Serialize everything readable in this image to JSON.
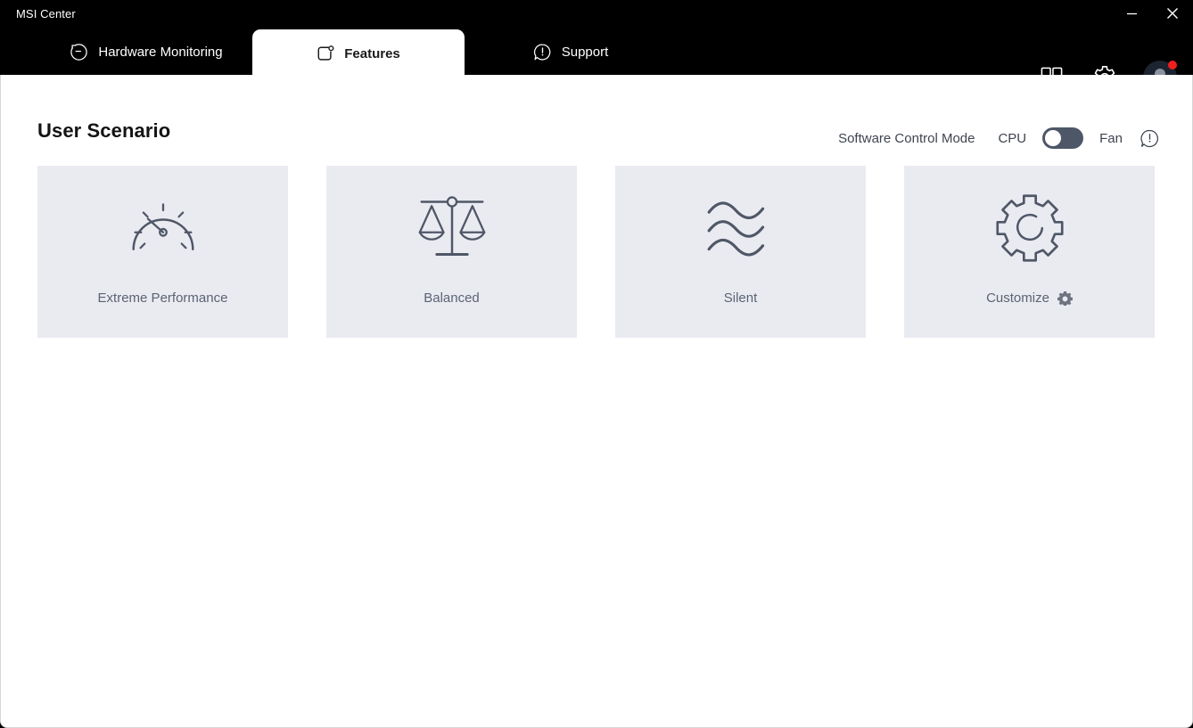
{
  "window": {
    "title": "MSI Center",
    "controls": [
      {
        "name": "minimize",
        "glyph": "minimize-icon"
      },
      {
        "name": "close",
        "glyph": "close-icon"
      }
    ]
  },
  "tabs": [
    {
      "id": "hardware-monitoring",
      "label": "Hardware Monitoring",
      "icon": "gauge-circle-icon",
      "active": false
    },
    {
      "id": "features",
      "label": "Features",
      "icon": "rounded-square-dot-icon",
      "active": true
    },
    {
      "id": "support",
      "label": "Support",
      "icon": "speech-bubble-alert-icon",
      "active": false
    }
  ],
  "header_icons": [
    {
      "id": "apps-grid",
      "icon": "grid-icon",
      "title": "Apps"
    },
    {
      "id": "settings",
      "icon": "gear-icon",
      "title": "Settings"
    },
    {
      "id": "account",
      "icon": "user-avatar-icon",
      "title": "Account",
      "has_notification": true
    }
  ],
  "page": {
    "title": "User Scenario"
  },
  "control_bar": {
    "mode_label": "Software Control Mode",
    "left_option": "CPU",
    "right_option": "Fan",
    "toggle_state": "left",
    "toggle_selected": "CPU",
    "info_icon": "info-bubble-icon"
  },
  "scenarios": [
    {
      "id": "extreme-performance",
      "label": "Extreme Performance",
      "icon": "speedometer-icon",
      "has_settings": false
    },
    {
      "id": "balanced",
      "label": "Balanced",
      "icon": "balance-scale-icon",
      "has_settings": false
    },
    {
      "id": "silent",
      "label": "Silent",
      "icon": "waves-icon",
      "has_settings": false
    },
    {
      "id": "customize",
      "label": "Customize",
      "icon": "gear-outline-icon",
      "has_settings": true,
      "settings_icon": "gear-small-icon"
    }
  ],
  "colors": {
    "titlebar_bg": "#000000",
    "content_bg": "#ffffff",
    "card_bg": "#eaebf1",
    "icon_stroke": "#4f5767",
    "label_text": "#5b6373",
    "toggle_track": "#4d5768",
    "notification": "#ef1f1f",
    "active_tab_bg": "#ffffff"
  }
}
